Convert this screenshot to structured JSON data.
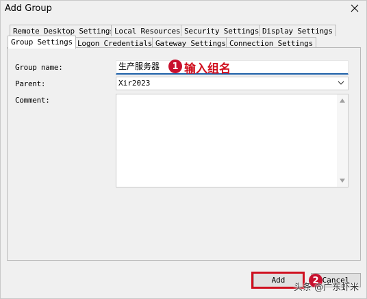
{
  "window": {
    "title": "Add Group"
  },
  "tabs_row1": [
    {
      "label": "Remote Desktop Settings"
    },
    {
      "label": "Local Resources"
    },
    {
      "label": "Security Settings"
    },
    {
      "label": "Display Settings"
    }
  ],
  "tabs_row2": [
    {
      "label": "Group Settings",
      "active": true
    },
    {
      "label": "Logon Credentials"
    },
    {
      "label": "Gateway Settings"
    },
    {
      "label": "Connection Settings"
    }
  ],
  "form": {
    "group_name_label": "Group name:",
    "group_name_value": "生产服务器",
    "parent_label": "Parent:",
    "parent_value": "Xir2023",
    "comment_label": "Comment:",
    "comment_value": ""
  },
  "annotations": {
    "step1_number": "1",
    "step1_text": "输入组名",
    "step2_number": "2"
  },
  "buttons": {
    "add_label": "Add",
    "cancel_label": "Cancel"
  },
  "watermark": "头条 @广东虾米",
  "colors": {
    "annotation_red": "#d0101f",
    "focus_blue": "#1c5fa8"
  }
}
